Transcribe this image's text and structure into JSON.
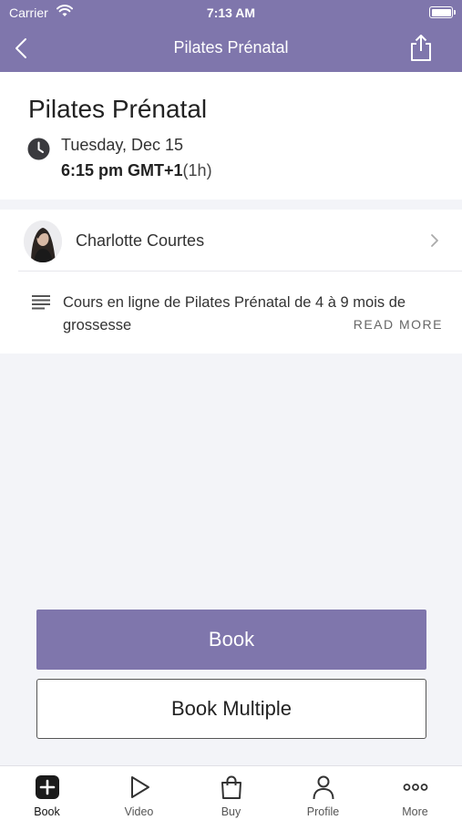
{
  "status_bar": {
    "carrier": "Carrier",
    "time": "7:13 AM",
    "battery_level": 1.0
  },
  "nav": {
    "title": "Pilates Prénatal",
    "back_icon": "chevron-left-icon",
    "share_icon": "share-icon"
  },
  "class": {
    "title": "Pilates Prénatal",
    "date": "Tuesday, Dec 15",
    "time": "6:15 pm GMT+1",
    "duration": "(1h)"
  },
  "instructor": {
    "name": "Charlotte Courtes"
  },
  "description": {
    "text": "Cours en ligne de Pilates Prénatal de 4 à 9 mois de grossesse",
    "read_more_label": "READ MORE"
  },
  "actions": {
    "book_label": "Book",
    "book_multiple_label": "Book Multiple"
  },
  "tabs": [
    {
      "label": "Book",
      "icon": "plus-square-icon",
      "active": true
    },
    {
      "label": "Video",
      "icon": "play-icon",
      "active": false
    },
    {
      "label": "Buy",
      "icon": "bag-icon",
      "active": false
    },
    {
      "label": "Profile",
      "icon": "person-icon",
      "active": false
    },
    {
      "label": "More",
      "icon": "ellipsis-icon",
      "active": false
    }
  ],
  "colors": {
    "accent": "#7f76ac",
    "background": "#f3f4f8"
  }
}
